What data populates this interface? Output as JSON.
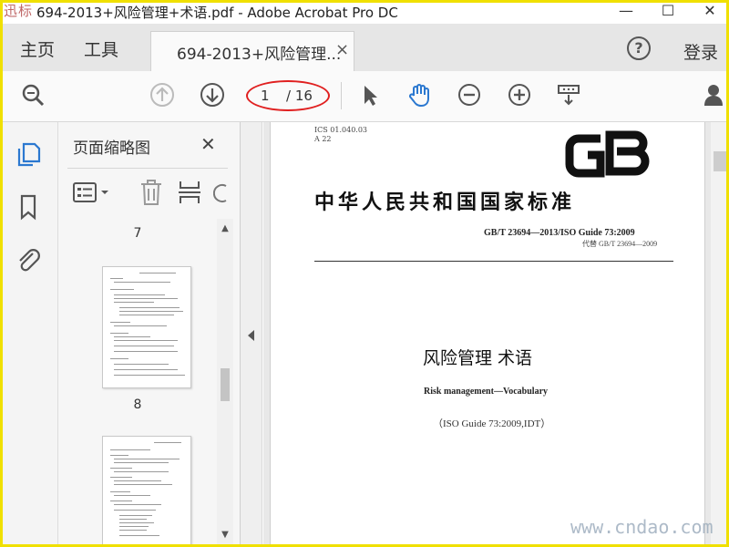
{
  "window": {
    "logo_text": "迅标网",
    "title": "694-2013+风险管理+术语.pdf - Adobe Acrobat Pro DC",
    "minimize": "—",
    "maximize": "☐",
    "close": "✕"
  },
  "tabs": {
    "home": "主页",
    "tools": "工具",
    "document": "694-2013+风险管理...",
    "document_close": "×",
    "help": "?",
    "login": "登录"
  },
  "toolbar": {
    "icons": [
      "zoom-search-icon",
      "page-up-icon",
      "page-down-icon",
      "select-arrow-icon",
      "hand-icon",
      "zoom-out-icon",
      "zoom-in-icon",
      "page-display-icon",
      "account-icon"
    ],
    "page_current": "1",
    "page_total": "/ 16",
    "highlight_color": "#e02020"
  },
  "rail": {
    "icons": [
      "page-thumbnails-icon",
      "bookmarks-icon",
      "attachments-icon"
    ],
    "active_color": "#2b78d0"
  },
  "panel": {
    "title": "页面缩略图",
    "close": "✕",
    "tools": [
      "options-menu-icon",
      "delete-page-icon",
      "extract-page-icon",
      "rotate-icon"
    ],
    "thumbnails": [
      {
        "label": "7"
      },
      {
        "label": "8"
      }
    ]
  },
  "document": {
    "ics_line1": "ICS 01.040.03",
    "ics_line2": "A 22",
    "gb_logo": "GB",
    "standard_title": "中华人民共和国国家标准",
    "standard_number": "GB/T 23694—2013/ISO Guide 73:2009",
    "replaces": "代替 GB/T 23694—2009",
    "cn_title": "风险管理   术语",
    "en_title": "Risk management—Vocabulary",
    "iso_ref": "（ISO Guide 73:2009,IDT）"
  },
  "watermark": "www.cndao.com"
}
